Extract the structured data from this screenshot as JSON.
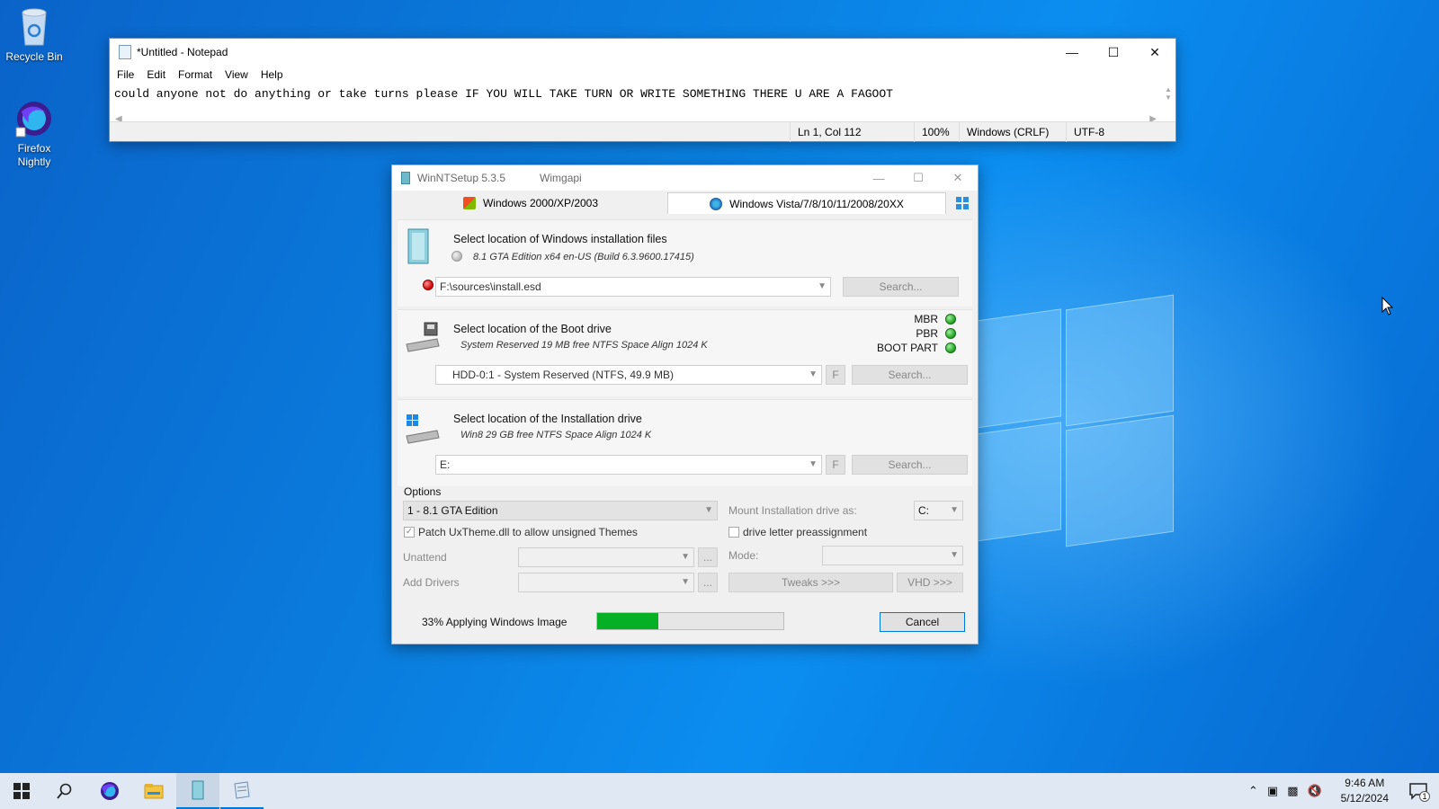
{
  "desktop": {
    "icons": [
      {
        "label": "Recycle Bin",
        "icon": "recycle-bin-icon"
      },
      {
        "label": "Firefox Nightly",
        "icon": "firefox-nightly-icon"
      }
    ]
  },
  "notepad": {
    "title": "*Untitled - Notepad",
    "menu": [
      "File",
      "Edit",
      "Format",
      "View",
      "Help"
    ],
    "text": "could anyone not do anything or take turns please IF YOU WILL TAKE TURN OR WRITE SOMETHING THERE U ARE A FAGOOT",
    "status": {
      "position": "Ln 1, Col 112",
      "zoom": "100%",
      "line_ending": "Windows (CRLF)",
      "encoding": "UTF-8"
    }
  },
  "winntsetup": {
    "title": "WinNTSetup 5.3.5",
    "title_extra": "Wimgapi",
    "tabs": [
      {
        "label": "Windows 2000/XP/2003",
        "active": false
      },
      {
        "label": "Windows Vista/7/8/10/11/2008/20XX",
        "active": true
      }
    ],
    "install_files": {
      "title": "Select location of Windows installation files",
      "subtitle": "8.1 GTA Edition  x64 en-US (Build 6.3.9600.17415)",
      "path": "F:\\sources\\install.esd",
      "search": "Search..."
    },
    "boot_drive": {
      "title": "Select location of the Boot drive",
      "subtitle": "System Reserved 19 MB free NTFS Space Align 1024 K",
      "value": "HDD-0:1 -  System Reserved (NTFS, 49.9 MB)",
      "f_button": "F",
      "search": "Search...",
      "indicators": [
        "MBR",
        "PBR",
        "BOOT PART"
      ]
    },
    "install_drive": {
      "title": "Select location of the Installation drive",
      "subtitle": "Win8 29 GB free NTFS Space Align 1024 K",
      "value": "E:",
      "f_button": "F",
      "search": "Search..."
    },
    "options": {
      "label": "Options",
      "edition": "1 - 8.1 GTA Edition",
      "mount_label": "Mount Installation drive as:",
      "mount_value": "C:",
      "patch_label": "Patch UxTheme.dll to allow unsigned Themes",
      "patch_checked": true,
      "preassign_label": "drive letter preassignment",
      "preassign_checked": false,
      "unattend_label": "Unattend",
      "mode_label": "Mode:",
      "add_drivers_label": "Add Drivers",
      "browse": "...",
      "tweaks": "Tweaks >>>",
      "vhd": "VHD >>>"
    },
    "progress": {
      "text": "33% Applying Windows Image",
      "percent": 33
    },
    "cancel": "Cancel"
  },
  "taskbar": {
    "items": [
      "start-icon",
      "search-icon",
      "firefox-icon",
      "file-explorer-icon",
      "winntsetup-icon",
      "notepad-icon"
    ],
    "clock_time": "9:46 AM",
    "clock_date": "5/12/2024",
    "notification_count": "1"
  },
  "colors": {
    "accent": "#0078d7",
    "progress_fill": "#06b025",
    "taskbar_bg": "#dfe8f3"
  }
}
